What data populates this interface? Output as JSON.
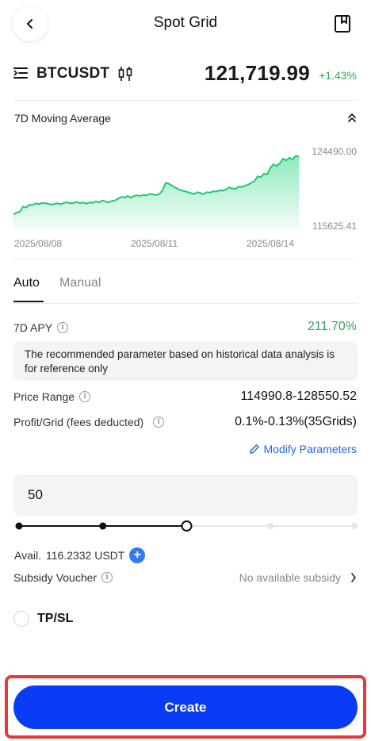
{
  "header": {
    "title": "Spot Grid"
  },
  "ticker": {
    "pair": "BTCUSDT",
    "price": "121,719.99",
    "change": "+1.43%",
    "change_color": "#2ea760"
  },
  "chart_section": {
    "label": "7D Moving Average"
  },
  "chart_data": {
    "type": "area",
    "title": "",
    "x_ticks": [
      "2025/08/08",
      "2025/08/11",
      "2025/08/14"
    ],
    "y_ticks": [
      "124490.00",
      "115625.41"
    ],
    "ylim": [
      115625.41,
      124490.0
    ],
    "series": [
      {
        "color": "#2ed47f",
        "values": [
          117300,
          117500,
          117600,
          118150,
          118050,
          118350,
          118300,
          118500,
          118400,
          118550,
          118500,
          118450,
          118350,
          118450,
          118500,
          118400,
          118550,
          118600,
          118500,
          118550,
          118650,
          118500,
          118600,
          118450,
          118600,
          118550,
          118700,
          118600,
          118800,
          118700,
          118600,
          118750,
          118800,
          119000,
          119200,
          119100,
          119300,
          119100,
          119300,
          119350,
          119300,
          119400,
          119350,
          119500,
          119450,
          119400,
          119500,
          119900,
          120700,
          120600,
          120400,
          120200,
          120000,
          119900,
          119800,
          119700,
          119600,
          119500,
          119700,
          119600,
          119500,
          119700,
          119650,
          119800,
          119750,
          119900,
          119850,
          120000,
          120200,
          120100,
          120050,
          120300,
          120250,
          120400,
          120500,
          120700,
          120900,
          121400,
          121300,
          121700,
          121600,
          122300,
          122700,
          122500,
          122800,
          123300,
          123100,
          123400,
          123200,
          123600,
          123500
        ]
      }
    ]
  },
  "tabs": [
    {
      "label": "Auto"
    },
    {
      "label": "Manual"
    }
  ],
  "apy": {
    "label": "7D APY",
    "value": "211.70%",
    "color": "#2ea760"
  },
  "note": "The recommended parameter based on historical data analysis is for reference only",
  "price_range": {
    "label": "Price Range",
    "value": "114990.8-128550.52"
  },
  "profit_grid": {
    "label": "Profit/Grid (fees deducted)",
    "value": "0.1%-0.13%(35Grids)"
  },
  "modify": {
    "label": "Modify Parameters"
  },
  "amount": {
    "value": "50"
  },
  "slider": {
    "fraction": 0.5
  },
  "avail": {
    "label": "Avail.",
    "value": "116.2332 USDT"
  },
  "subsidy": {
    "label": "Subsidy Voucher",
    "value": "No available subsidy"
  },
  "tpsl": {
    "label": "TP/SL"
  },
  "create": {
    "label": "Create"
  }
}
